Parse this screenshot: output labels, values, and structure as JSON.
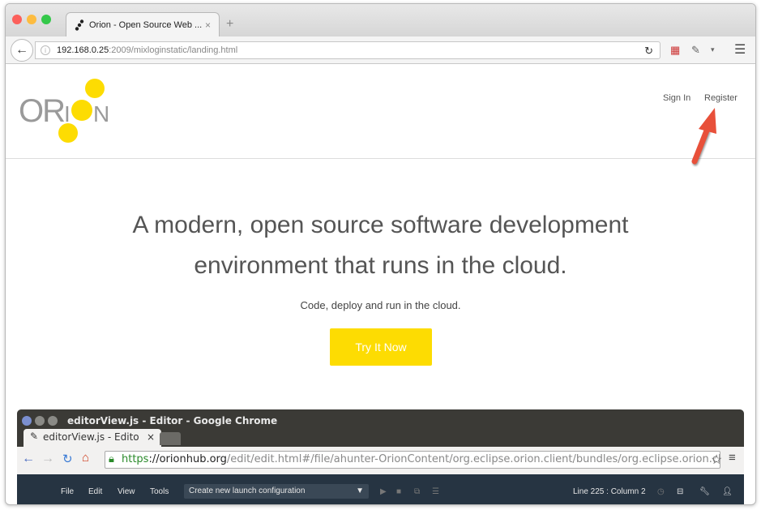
{
  "browser": {
    "tab_title": "Orion - Open Source Web ...",
    "tab_close": "×",
    "new_tab": "+",
    "url_host": "192.168.0.25",
    "url_rest": ":2009/mixloginstatic/landing.html"
  },
  "header": {
    "logo_text": "ORION",
    "sign_in": "Sign In",
    "register": "Register"
  },
  "hero": {
    "line1": "A modern, open source software development",
    "line2": "environment that runs in the cloud.",
    "subtitle": "Code, deploy and run in the cloud.",
    "cta": "Try It Now"
  },
  "embedded": {
    "window_title": "editorView.js - Editor - Google Chrome",
    "tab_title": "editorView.js - Edito",
    "tab_close": "×",
    "url_scheme": "https",
    "url_host": "://orionhub.org",
    "url_path": "/edit/edit.html#/file/ahunter-OrionContent/org.eclipse.orion.client/bundles/org.eclipse.orion.clie",
    "menu": [
      "File",
      "Edit",
      "View",
      "Tools"
    ],
    "launch_config": "Create new launch configuration",
    "status": "Line 225 : Column 2"
  },
  "colors": {
    "accent": "#fddc02",
    "arrow": "#e8503a",
    "editor_toolbar": "#263442"
  }
}
